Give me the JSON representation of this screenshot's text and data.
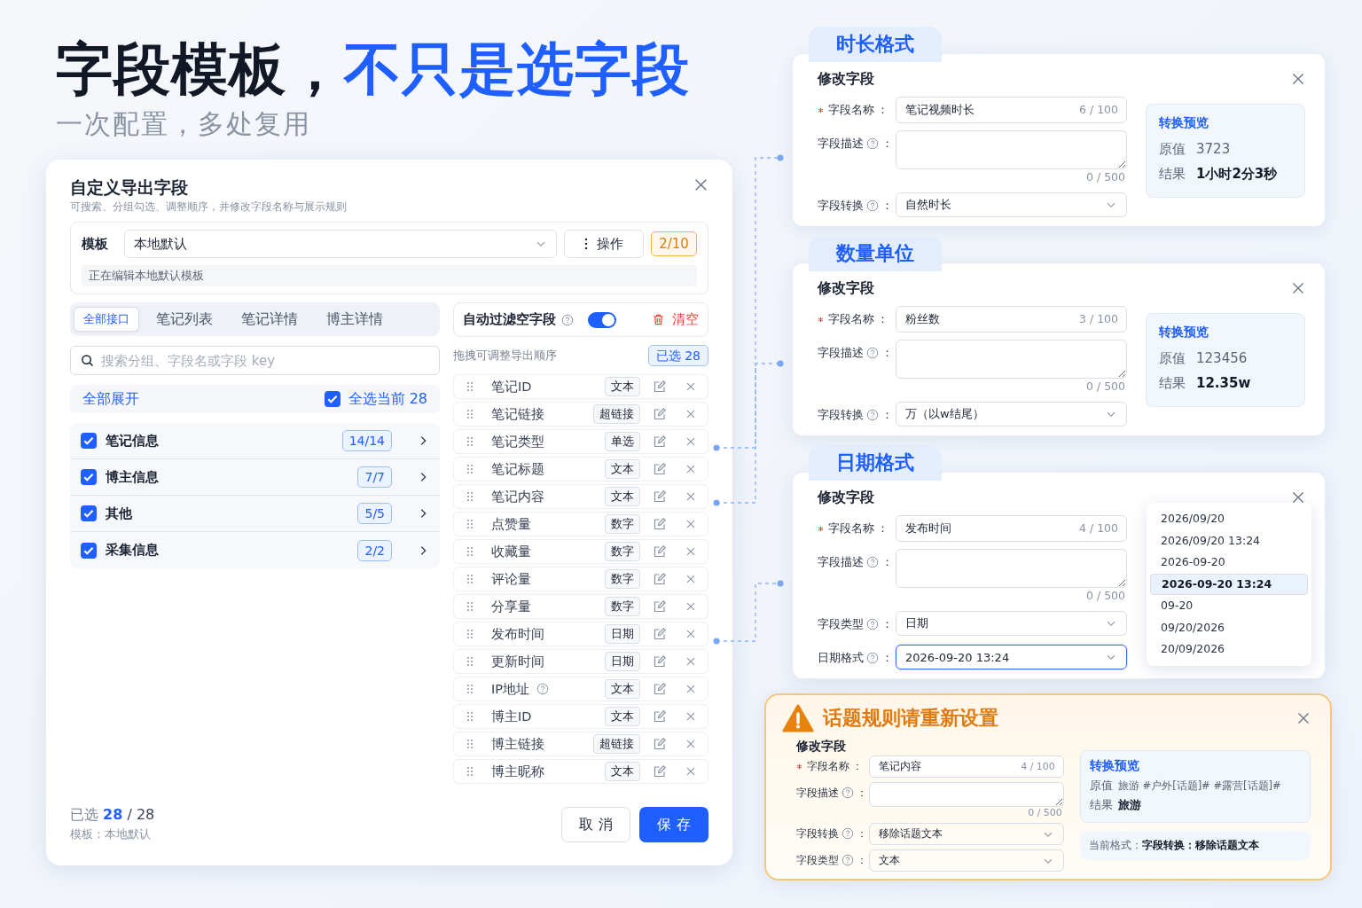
{
  "headline": {
    "main": "字段模板，",
    "accent": "不只是选字段"
  },
  "subtitle": "一次配置，多处复用",
  "dialog": {
    "title": "自定义导出字段",
    "subtitle": "可搜索、分组勾选、调整顺序，并修改字段名称与展示规则",
    "template": {
      "label": "模板",
      "value": "本地默认",
      "action": "操作",
      "count": "2/10",
      "note": "正在编辑本地默认模板"
    },
    "tabs": [
      {
        "label": "全部接口",
        "selected": true
      },
      {
        "label": "笔记列表",
        "selected": false
      },
      {
        "label": "笔记详情",
        "selected": false
      },
      {
        "label": "博主详情",
        "selected": false
      }
    ],
    "search": {
      "placeholder": "搜索分组、字段名或字段 key"
    },
    "expand_all": "全部展开",
    "select_all": {
      "label": "全选当前 28",
      "checked": true
    },
    "groups": [
      {
        "name": "笔记信息",
        "count": "14/14",
        "checked": true
      },
      {
        "name": "博主信息",
        "count": "7/7",
        "checked": true
      },
      {
        "name": "其他",
        "count": "5/5",
        "checked": true
      },
      {
        "name": "采集信息",
        "count": "2/2",
        "checked": true
      }
    ],
    "auto_filter": {
      "label": "自动过滤空字段",
      "on": true
    },
    "clear": "清空",
    "drag_hint": "拖拽可调整导出顺序",
    "selected_badge": "已选 28",
    "fields": [
      {
        "name": "笔记ID",
        "type": "文本",
        "help": false
      },
      {
        "name": "笔记链接",
        "type": "超链接",
        "help": false
      },
      {
        "name": "笔记类型",
        "type": "单选",
        "help": false
      },
      {
        "name": "笔记标题",
        "type": "文本",
        "help": false
      },
      {
        "name": "笔记内容",
        "type": "文本",
        "help": false
      },
      {
        "name": "点赞量",
        "type": "数字",
        "help": false
      },
      {
        "name": "收藏量",
        "type": "数字",
        "help": false
      },
      {
        "name": "评论量",
        "type": "数字",
        "help": false
      },
      {
        "name": "分享量",
        "type": "数字",
        "help": false
      },
      {
        "name": "发布时间",
        "type": "日期",
        "help": false
      },
      {
        "name": "更新时间",
        "type": "日期",
        "help": false
      },
      {
        "name": "IP地址",
        "type": "文本",
        "help": true
      },
      {
        "name": "博主ID",
        "type": "文本",
        "help": false
      },
      {
        "name": "博主链接",
        "type": "超链接",
        "help": false
      },
      {
        "name": "博主昵称",
        "type": "文本",
        "help": false
      }
    ],
    "footer": {
      "selected_label": "已选",
      "selected": "28",
      "total": "/ 28",
      "template": "模板：本地默认"
    },
    "buttons": {
      "cancel": "取 消",
      "save": "保 存"
    }
  },
  "cards": [
    {
      "kind": "preview",
      "tab": "时长格式",
      "title": "修改字段",
      "rows": [
        {
          "kind": "input",
          "label": "字段名称",
          "colon": "：",
          "required": true,
          "help": false,
          "focused": false,
          "value": "笔记视频时长",
          "count": "6 / 100"
        },
        {
          "kind": "textarea",
          "label": "字段描述",
          "colon": "：",
          "required": false,
          "help": true,
          "focused": false,
          "count": "0 / 500"
        },
        {
          "kind": "select",
          "label": "字段转换",
          "colon": "：",
          "required": false,
          "help": true,
          "focused": false,
          "value": "自然时长"
        }
      ],
      "preview": {
        "title": "转换预览",
        "original_label": "原值",
        "original": "3723",
        "result_label": "结果",
        "result": "1小时2分3秒"
      }
    },
    {
      "kind": "preview",
      "tab": "数量单位",
      "title": "修改字段",
      "rows": [
        {
          "kind": "input",
          "label": "字段名称",
          "colon": "：",
          "required": true,
          "help": false,
          "focused": false,
          "value": "粉丝数",
          "count": "3 / 100"
        },
        {
          "kind": "textarea",
          "label": "字段描述",
          "colon": "：",
          "required": false,
          "help": true,
          "focused": false,
          "count": "0 / 500"
        },
        {
          "kind": "select",
          "label": "字段转换",
          "colon": "：",
          "required": false,
          "help": true,
          "focused": false,
          "value": "万（以w结尾）"
        }
      ],
      "preview": {
        "title": "转换预览",
        "original_label": "原值",
        "original": "123456",
        "result_label": "结果",
        "result": "12.35w"
      }
    },
    {
      "kind": "dropdown",
      "tab": "日期格式",
      "title": "修改字段",
      "rows": [
        {
          "kind": "input",
          "label": "字段名称",
          "colon": "：",
          "required": true,
          "help": false,
          "focused": false,
          "value": "发布时间",
          "count": "4 / 100"
        },
        {
          "kind": "textarea",
          "label": "字段描述",
          "colon": "：",
          "required": false,
          "help": true,
          "focused": false,
          "count": "0 / 500"
        },
        {
          "kind": "select",
          "label": "字段类型",
          "colon": "：",
          "required": false,
          "help": true,
          "focused": false,
          "value": "日期"
        },
        {
          "kind": "select",
          "label": "日期格式",
          "colon": "：",
          "required": false,
          "help": true,
          "focused": true,
          "value": "2026-09-20 13:24"
        }
      ],
      "options": [
        {
          "label": "2026/09/20",
          "selected": false
        },
        {
          "label": "2026/09/20 13:24",
          "selected": false
        },
        {
          "label": "2026-09-20",
          "selected": false
        },
        {
          "label": "2026-09-20 13:24",
          "selected": true
        },
        {
          "label": "09-20",
          "selected": false
        },
        {
          "label": "09/20/2026",
          "selected": false
        },
        {
          "label": "20/09/2026",
          "selected": false
        }
      ]
    },
    {
      "kind": "warning",
      "warning": "话题规则请重新设置",
      "title": "修改字段",
      "rows": [
        {
          "kind": "input",
          "label": "字段名称",
          "colon": "：",
          "required": true,
          "help": false,
          "focused": false,
          "value": "笔记内容",
          "count": "4 / 100"
        },
        {
          "kind": "textarea",
          "label": "字段描述",
          "colon": "：",
          "required": false,
          "help": true,
          "focused": false,
          "count": "0 / 500"
        },
        {
          "kind": "select",
          "label": "字段转换",
          "colon": "：",
          "required": false,
          "help": true,
          "focused": false,
          "value": "移除话题文本"
        },
        {
          "kind": "select",
          "label": "字段类型",
          "colon": "：",
          "required": false,
          "help": true,
          "focused": false,
          "value": "文本"
        }
      ],
      "preview": {
        "title": "转换预览",
        "original_label": "原值",
        "original": "旅游 #户外[话题]# #露营[话题]#",
        "result_label": "结果",
        "result": "旅游"
      },
      "note": {
        "label": "当前格式：",
        "value": "字段转换：移除话题文本"
      }
    }
  ]
}
